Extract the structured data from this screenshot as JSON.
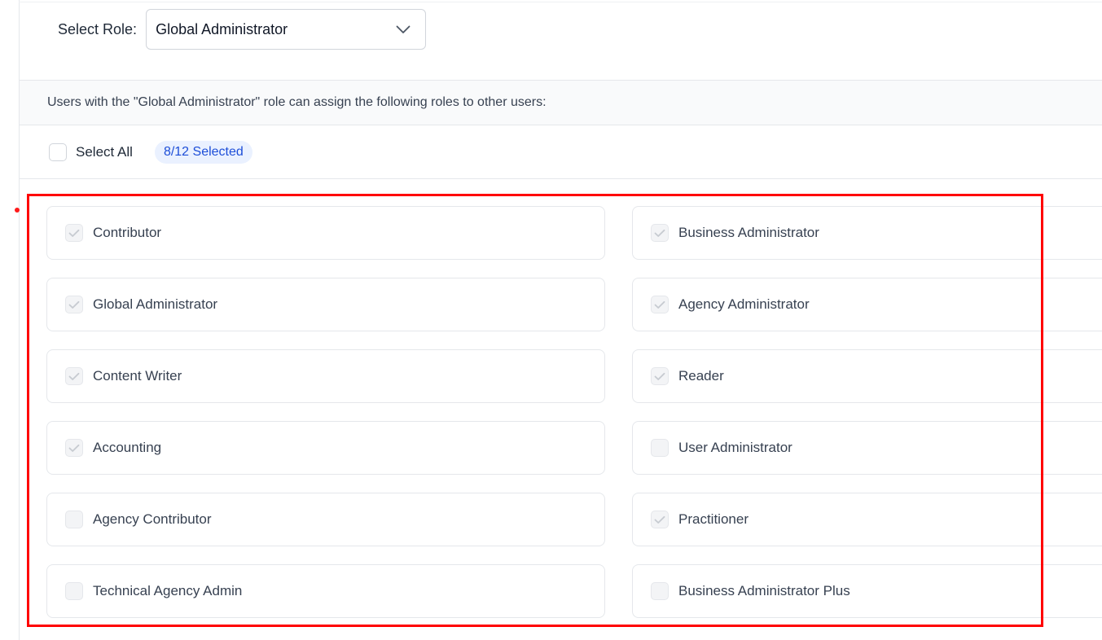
{
  "role_selector": {
    "label": "Select Role:",
    "value": "Global Administrator"
  },
  "info": {
    "text": "Users with the \"Global Administrator\" role can assign the following roles to other users:"
  },
  "select_all": {
    "label": "Select All",
    "checked": false,
    "badge": "8/12 Selected"
  },
  "roles": [
    {
      "label": "Contributor",
      "checked": true
    },
    {
      "label": "Business Administrator",
      "checked": true
    },
    {
      "label": "Global Administrator",
      "checked": true
    },
    {
      "label": "Agency Administrator",
      "checked": true
    },
    {
      "label": "Content Writer",
      "checked": true
    },
    {
      "label": "Reader",
      "checked": true
    },
    {
      "label": "Accounting",
      "checked": true
    },
    {
      "label": "User Administrator",
      "checked": false
    },
    {
      "label": "Agency Contributor",
      "checked": false
    },
    {
      "label": "Practitioner",
      "checked": true
    },
    {
      "label": "Technical Agency Admin",
      "checked": false
    },
    {
      "label": "Business Administrator Plus",
      "checked": false
    }
  ],
  "colors": {
    "accent": "#1d4ed8",
    "badge_bg": "#eaf1ff",
    "highlight": "#ff0000",
    "checkmark": "#c7cbd1"
  },
  "icons": {
    "dropdown": "chevron-down-icon",
    "check": "checkmark-icon"
  }
}
